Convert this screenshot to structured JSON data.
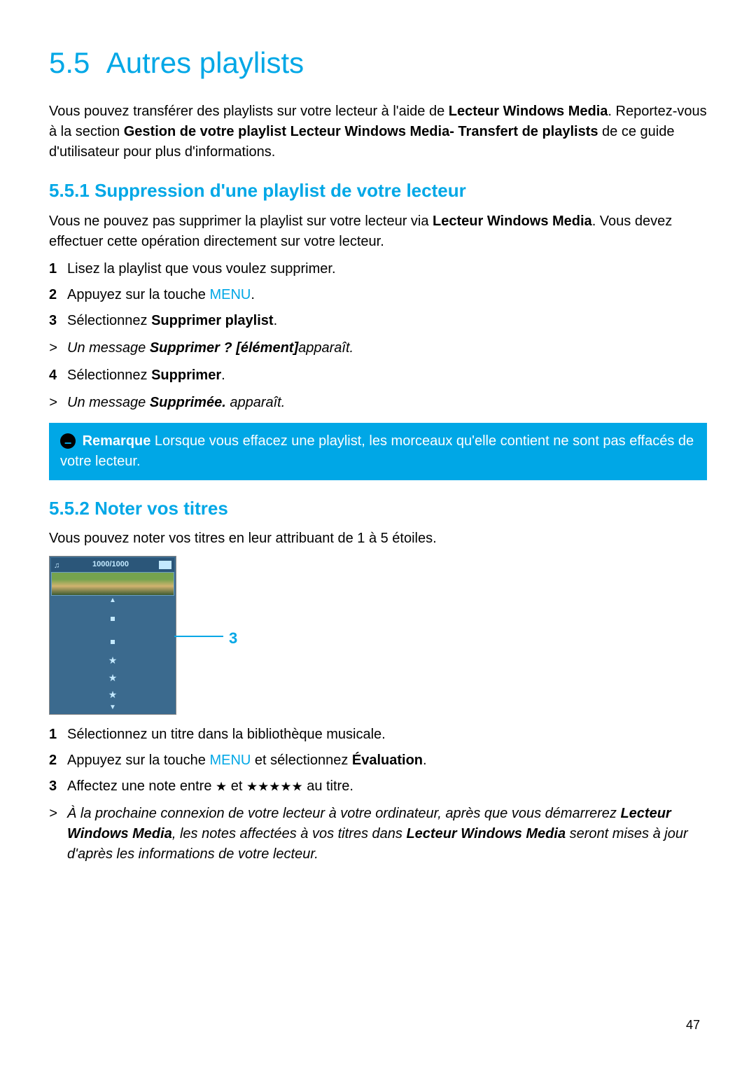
{
  "page_number": "47",
  "section": {
    "number": "5.5",
    "title": "Autres playlists",
    "intro_parts": [
      "Vous pouvez transférer des playlists sur votre lecteur à l'aide de ",
      "Lecteur Windows Media",
      ". Reportez-vous à la section ",
      "Gestion de votre playlist Lecteur Windows Media- Transfert de playlists",
      " de ce guide d'utilisateur pour plus d'informations."
    ]
  },
  "sub1": {
    "number": "5.5.1",
    "title": "Suppression d'une playlist de votre lecteur",
    "intro_parts": [
      "Vous ne pouvez pas supprimer la playlist sur votre lecteur via ",
      "Lecteur Windows Media",
      ". Vous devez effectuer cette opération directement sur votre lecteur."
    ],
    "steps": [
      {
        "n": "1",
        "text": "Lisez la playlist que vous voulez supprimer."
      },
      {
        "n": "2",
        "pre": "Appuyez sur la touche ",
        "menu": "MENU",
        "post": "."
      },
      {
        "n": "3",
        "pre": "Sélectionnez ",
        "bold": "Supprimer playlist",
        "post": "."
      }
    ],
    "result1_pre": "Un message ",
    "result1_bold": "Supprimer ? [élément]",
    "result1_post": "apparaît.",
    "step4_n": "4",
    "step4_pre": "Sélectionnez ",
    "step4_bold": "Supprimer",
    "step4_post": ".",
    "result2_pre": "Un message ",
    "result2_bold": "Supprimée.",
    "result2_post": " apparaît.",
    "note_label": "Remarque",
    "note_text": " Lorsque vous effacez une playlist, les morceaux qu'elle contient ne sont pas effacés de votre lecteur."
  },
  "sub2": {
    "number": "5.5.2",
    "title": "Noter vos titres",
    "intro": "Vous pouvez noter vos titres en leur attribuant de 1 à 5 étoiles.",
    "screen": {
      "counter": "1000/1000",
      "callout": "3"
    },
    "steps": [
      {
        "n": "1",
        "text": "Sélectionnez un titre dans la bibliothèque musicale."
      },
      {
        "n": "2",
        "pre": "Appuyez sur la touche ",
        "menu": "MENU",
        "mid": " et sélectionnez ",
        "bold": "Évaluation",
        "post": "."
      },
      {
        "n": "3",
        "pre": "Affectez une note entre ",
        "stars1": "★",
        "mid": " et ",
        "stars5": "★★★★★",
        "post": " au titre."
      }
    ],
    "result_pre": "À la prochaine connexion de votre lecteur à votre ordinateur, après que vous démarrerez ",
    "result_b1": "Lecteur Windows Media",
    "result_mid": ", les notes affectées à vos titres dans ",
    "result_b2": "Lecteur Windows Media",
    "result_post": " seront mises à jour d'après les informations de votre lecteur."
  }
}
